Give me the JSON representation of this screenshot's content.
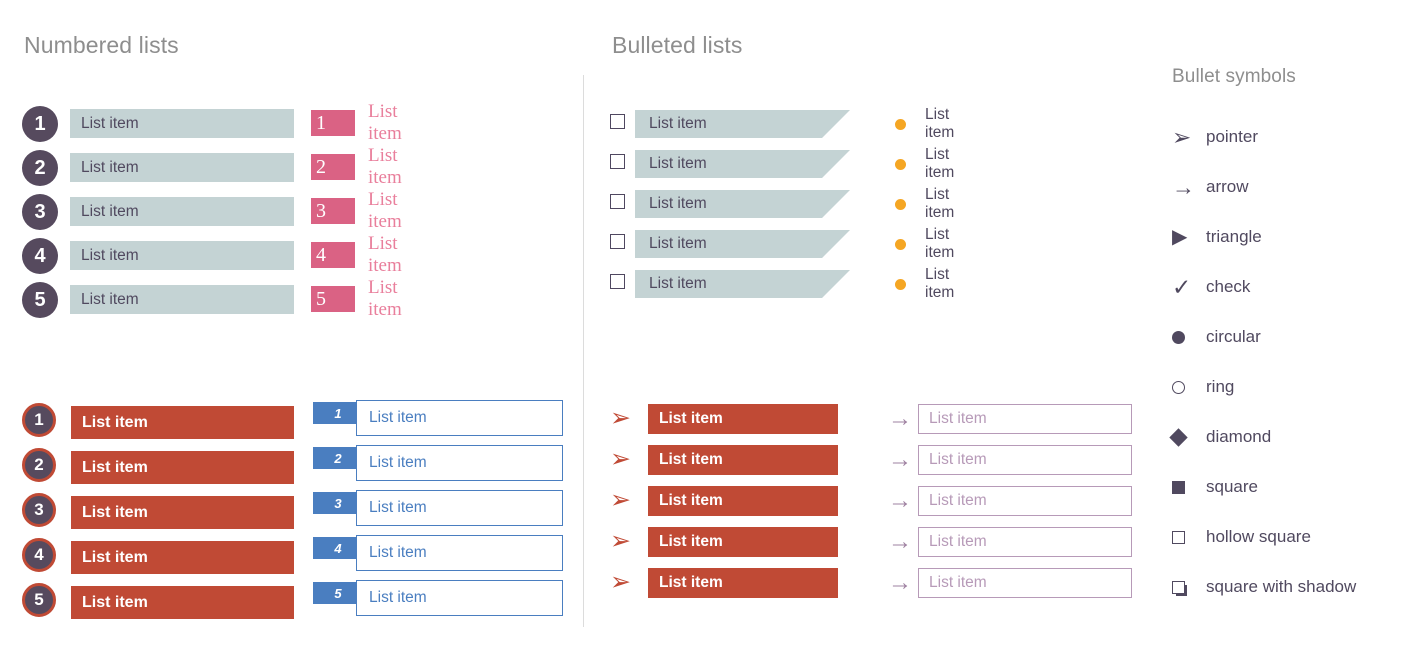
{
  "headings": {
    "numbered": "Numbered lists",
    "bulleted": "Bulleted lists",
    "symbols": "Bullet symbols"
  },
  "colors": {
    "heading_gray": "#8e8e8e",
    "dark_purple": "#564a5e",
    "text_purple": "#50495f",
    "teal_bar": "#c4d3d4",
    "pink": "#da6284",
    "pink_text": "#e97f9c",
    "brick_red": "#c04a35",
    "blue": "#4a7ec0",
    "orange": "#f5a623",
    "mauve": "#b79ab8",
    "divider": "#dcdcdc"
  },
  "lists": {
    "circle_numbered": {
      "items": [
        {
          "number": "1",
          "label": "List item"
        },
        {
          "number": "2",
          "label": "List item"
        },
        {
          "number": "3",
          "label": "List item"
        },
        {
          "number": "4",
          "label": "List item"
        },
        {
          "number": "5",
          "label": "List item"
        }
      ]
    },
    "pink_numbered": {
      "items": [
        {
          "number": "1",
          "label": "List item"
        },
        {
          "number": "2",
          "label": "List item"
        },
        {
          "number": "3",
          "label": "List item"
        },
        {
          "number": "4",
          "label": "List item"
        },
        {
          "number": "5",
          "label": "List item"
        }
      ]
    },
    "red_numbered": {
      "items": [
        {
          "number": "1",
          "label": "List item"
        },
        {
          "number": "2",
          "label": "List item"
        },
        {
          "number": "3",
          "label": "List item"
        },
        {
          "number": "4",
          "label": "List item"
        },
        {
          "number": "5",
          "label": "List item"
        }
      ]
    },
    "blue_numbered": {
      "items": [
        {
          "number": "1",
          "label": "List item"
        },
        {
          "number": "2",
          "label": "List item"
        },
        {
          "number": "3",
          "label": "List item"
        },
        {
          "number": "4",
          "label": "List item"
        },
        {
          "number": "5",
          "label": "List item"
        }
      ]
    },
    "checkbox_banner": {
      "items": [
        {
          "label": "List item"
        },
        {
          "label": "List item"
        },
        {
          "label": "List item"
        },
        {
          "label": "List item"
        },
        {
          "label": "List item"
        }
      ]
    },
    "orange_dot": {
      "items": [
        {
          "label": "List item"
        },
        {
          "label": "List item"
        },
        {
          "label": "List item"
        },
        {
          "label": "List item"
        },
        {
          "label": "List item"
        }
      ]
    },
    "pointer_red": {
      "bullet": "➢",
      "items": [
        {
          "label": "List item"
        },
        {
          "label": "List item"
        },
        {
          "label": "List item"
        },
        {
          "label": "List item"
        },
        {
          "label": "List item"
        }
      ]
    },
    "arrow_outline": {
      "bullet": "→",
      "items": [
        {
          "label": "List item"
        },
        {
          "label": "List item"
        },
        {
          "label": "List item"
        },
        {
          "label": "List item"
        },
        {
          "label": "List item"
        }
      ]
    }
  },
  "bullet_symbols": [
    {
      "glyph": "➢",
      "name": "pointer"
    },
    {
      "glyph": "→",
      "name": "arrow"
    },
    {
      "glyph": "▶",
      "name": "triangle"
    },
    {
      "glyph": "✓",
      "name": "check"
    },
    {
      "glyph": "●",
      "name": "circular"
    },
    {
      "glyph": "○",
      "name": "ring"
    },
    {
      "glyph": "◆",
      "name": "diamond"
    },
    {
      "glyph": "■",
      "name": "square"
    },
    {
      "glyph": "□",
      "name": "hollow square"
    },
    {
      "glyph": "❑",
      "name": "square with shadow"
    }
  ]
}
